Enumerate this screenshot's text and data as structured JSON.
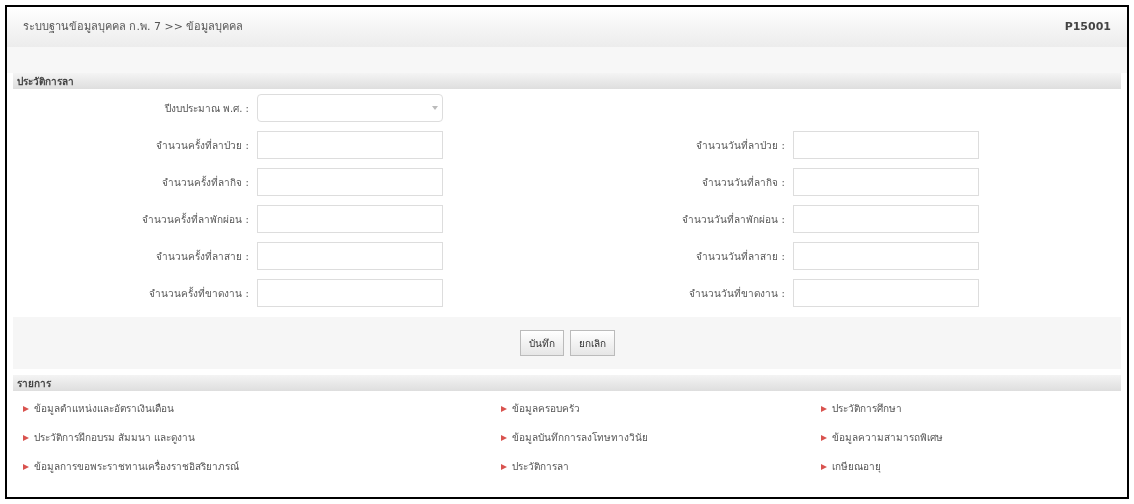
{
  "header": {
    "title": "ระบบฐานข้อมูลบุคคล ก.พ. 7 >> ข้อมูลบุคคล",
    "code": "P15001"
  },
  "leave_section": {
    "title": "ประวัติการลา",
    "year_field": {
      "label": "ปีงบประมาณ พ.ศ. :"
    },
    "fields": [
      {
        "label": "จำนวนครั้งที่ลาป่วย :"
      },
      {
        "label": "จำนวนวันที่ลาป่วย :"
      },
      {
        "label": "จำนวนครั้งที่ลากิจ :"
      },
      {
        "label": "จำนวนวันที่ลากิจ :"
      },
      {
        "label": "จำนวนครั้งที่ลาพักผ่อน :"
      },
      {
        "label": "จำนวนวันที่ลาพักผ่อน :"
      },
      {
        "label": "จำนวนครั้งที่ลาสาย :"
      },
      {
        "label": "จำนวนวันที่ลาสาย :"
      },
      {
        "label": "จำนวนครั้งที่ขาดงาน :"
      },
      {
        "label": "จำนวนวันที่ขาดงาน :"
      }
    ],
    "buttons": [
      "บันทึก",
      "ยกเลิก"
    ]
  },
  "links_section": {
    "title": "รายการ",
    "links": [
      "ข้อมูลตำแหน่งและอัตราเงินเดือน",
      "ข้อมูลครอบครัว",
      "ประวัติการศึกษา",
      "ประวัติการฝึกอบรม สัมมนา และดูงาน",
      "ข้อมูลบันทึกการลงโทษทางวินัย",
      "ข้อมูลความสามารถพิเศษ",
      "ข้อมูลการขอพระราชทานเครื่องราชอิสริยาภรณ์",
      "ประวัติการลา",
      "เกษียณอายุ"
    ]
  }
}
